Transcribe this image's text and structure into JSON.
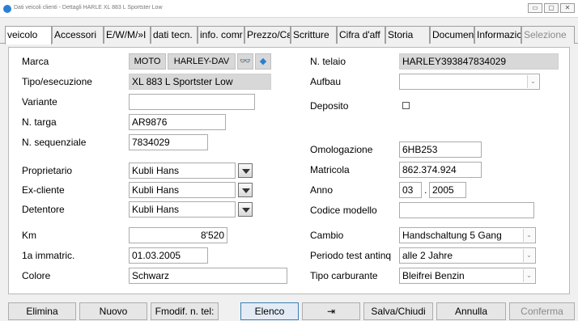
{
  "window": {
    "title": "Dati veicoli clienti - Dettagli HARLE XL 883 L Sportster Low",
    "controls": [
      "▭",
      "▢",
      "✕"
    ]
  },
  "tabs": [
    {
      "label": "veicolo",
      "active": true
    },
    {
      "label": "Accessori"
    },
    {
      "label": "E/W/M/»I"
    },
    {
      "label": "dati tecn."
    },
    {
      "label": "info. comr"
    },
    {
      "label": "Prezzo/Cε"
    },
    {
      "label": "Scritture"
    },
    {
      "label": "Cifra d'aff"
    },
    {
      "label": "Storia"
    },
    {
      "label": "Document"
    },
    {
      "label": "Informazic"
    },
    {
      "label": "Selezione",
      "disabled": true
    }
  ],
  "form": {
    "marca_label": "Marca",
    "marca_value": "MOTO",
    "marca_brand": "HARLEY-DAV",
    "marca_binoculars": "👓",
    "marca_arrow": "◆",
    "tipo_label": "Tipo/esecuzione",
    "tipo_value": "XL 883 L Sportster Low",
    "variante_label": "Variante",
    "variante_value": "",
    "targa_label": "N. targa",
    "targa_value": "AR9876",
    "sequenziale_label": "N. sequenziale",
    "sequenziale_value": "7834029",
    "proprietario_label": "Proprietario",
    "proprietario_value": "Kubli Hans",
    "excliente_label": "Ex-cliente",
    "excliente_value": "Kubli Hans",
    "detentore_label": "Detentore",
    "detentore_value": "Kubli Hans",
    "km_label": "Km",
    "km_value": "8'520",
    "immatric_label": "1a immatric.",
    "immatric_value": "01.03.2005",
    "colore_label": "Colore",
    "colore_value": "Schwarz",
    "telaio_label": "N. telaio",
    "telaio_value": "HARLEY393847834029",
    "aufbau_label": "Aufbau",
    "aufbau_value": "",
    "deposito_label": "Deposito",
    "omologazione_label": "Omologazione",
    "omologazione_value": "6HB253",
    "matricola_label": "Matricola",
    "matricola_value": "862.374.924",
    "anno_label": "Anno",
    "anno_month": "03",
    "anno_sep": ".",
    "anno_year": "2005",
    "codice_label": "Codice modello",
    "codice_value": "",
    "cambio_label": "Cambio",
    "cambio_value": "Handschaltung 5 Gang",
    "periodo_label": "Periodo test antinq",
    "periodo_value": "alle 2 Jahre",
    "carburante_label": "Tipo carburante",
    "carburante_value": "Bleifrei Benzin"
  },
  "buttons": {
    "elimina": "Elimina",
    "nuovo": "Nuovo",
    "fmodif": "Fmodif. n. tel:",
    "elenco": "Elenco",
    "jump": "⇥",
    "salva": "Salva/Chiudi",
    "annulla": "Annulla",
    "conferma": "Conferma"
  }
}
